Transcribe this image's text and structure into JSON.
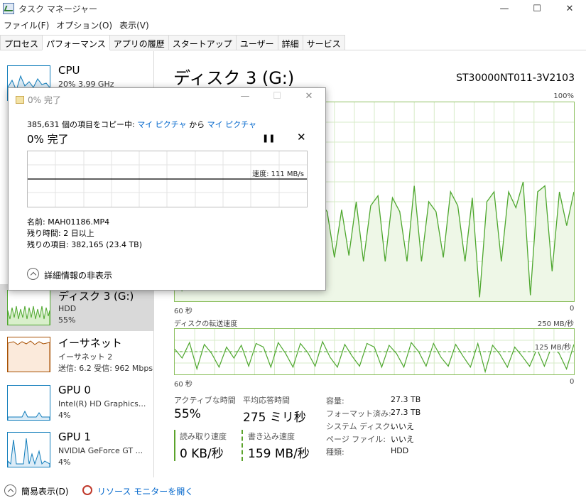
{
  "window": {
    "title": "タスク マネージャー",
    "minimize": "—",
    "maximize": "☐",
    "close": "✕"
  },
  "menu": [
    "ファイル(F)",
    "オプション(O)",
    "表示(V)"
  ],
  "tabs": [
    "プロセス",
    "パフォーマンス",
    "アプリの履歴",
    "スタートアップ",
    "ユーザー",
    "詳細",
    "サービス"
  ],
  "active_tab": 1,
  "sidebar": [
    {
      "name": "CPU",
      "line2": "20%  3.99 GHz",
      "line3": ""
    },
    {
      "name": "ディスク 3 (G:)",
      "line2": "HDD",
      "line3": "55%"
    },
    {
      "name": "イーサネット",
      "line2": "イーサネット 2",
      "line3": "送信: 6.2  受信: 962 Mbps"
    },
    {
      "name": "GPU 0",
      "line2": "Intel(R) HD Graphics...",
      "line3": "4%"
    },
    {
      "name": "GPU 1",
      "line2": "NVIDIA GeForce GT ...",
      "line3": "4%"
    }
  ],
  "colors": {
    "disk": "#4ea72e",
    "disk_fill": "#eef7e7",
    "cpu": "#117dbb",
    "ethernet": "#a74f01",
    "grid": "#d7ebc8"
  },
  "main": {
    "title": "ディスク 3 (G:)",
    "model": "ST30000NT011-3V2103",
    "chart_top_right": "100%",
    "axis_left": "60 秒",
    "axis_right": "0",
    "transfer_label": "ディスクの転送速度",
    "transfer_max": "250 MB/秒",
    "transfer_mid": "125 MB/秒",
    "axis2_left": "60 秒",
    "axis2_right": "0"
  },
  "stats": {
    "active_label": "アクティブな時間",
    "active_value": "55%",
    "resp_label": "平均応答時間",
    "resp_value": "275 ミリ秒",
    "read_label": "読み取り速度",
    "read_value": "0 KB/秒",
    "write_label": "書き込み速度",
    "write_value": "159 MB/秒"
  },
  "info": [
    {
      "k": "容量:",
      "v": "27.3 TB"
    },
    {
      "k": "フォーマット済み:",
      "v": "27.3 TB"
    },
    {
      "k": "システム ディスク:",
      "v": "いいえ"
    },
    {
      "k": "ページ ファイル:",
      "v": "いいえ"
    },
    {
      "k": "種類:",
      "v": "HDD"
    }
  ],
  "bottom": {
    "fewer_details": "簡易表示(D)",
    "resource_monitor": "リソース モニターを開く"
  },
  "dialog": {
    "title": "0% 完了",
    "desc_prefix": "385,631 個の項目をコピー中: ",
    "src": "マイ ピクチャ",
    "mid": " から ",
    "dst": "マイ ピクチャ",
    "percent": "0% 完了",
    "pause": "❚❚",
    "close": "✕",
    "speed": "速度: 111 MB/s",
    "name": "名前:  MAH01186.MP4",
    "time_left": "残り時間:  2 日以上",
    "items_left": "残りの項目:  382,165 (23.4 TB)",
    "details": "詳細情報の非表示"
  },
  "chart_data": [
    {
      "type": "area",
      "title": "ディスク 3 (G:)",
      "ylim": [
        0,
        100
      ],
      "x_range_seconds": [
        60,
        0
      ],
      "values": [
        42,
        5,
        30,
        58,
        25,
        62,
        44,
        50,
        42,
        22,
        48,
        58,
        22,
        50,
        25,
        52,
        42,
        22,
        55,
        20,
        50,
        45,
        22,
        46,
        23,
        50,
        20,
        48,
        53,
        20,
        52,
        45,
        20,
        58,
        20,
        50,
        45,
        22,
        55,
        48,
        20,
        52,
        2,
        50,
        55,
        20,
        55,
        47,
        60,
        3,
        55,
        58,
        15,
        55,
        38,
        55
      ]
    },
    {
      "type": "line",
      "title": "ディスクの転送速度",
      "ylim": [
        0,
        250
      ],
      "x_range_seconds": [
        60,
        0
      ],
      "series": [
        {
          "values": [
            140,
            90,
            175,
            30,
            165,
            115,
            40,
            150,
            90,
            160,
            45,
            170,
            150,
            40,
            175,
            115,
            40,
            170,
            120,
            45,
            180,
            95,
            40,
            165,
            100,
            45,
            170,
            150,
            40,
            160,
            115,
            40,
            175,
            125,
            45,
            170,
            95,
            45,
            165,
            100,
            40,
            170,
            15,
            160,
            110,
            40,
            150,
            100,
            45,
            140,
            45,
            155,
            115,
            30,
            165
          ]
        }
      ]
    }
  ]
}
